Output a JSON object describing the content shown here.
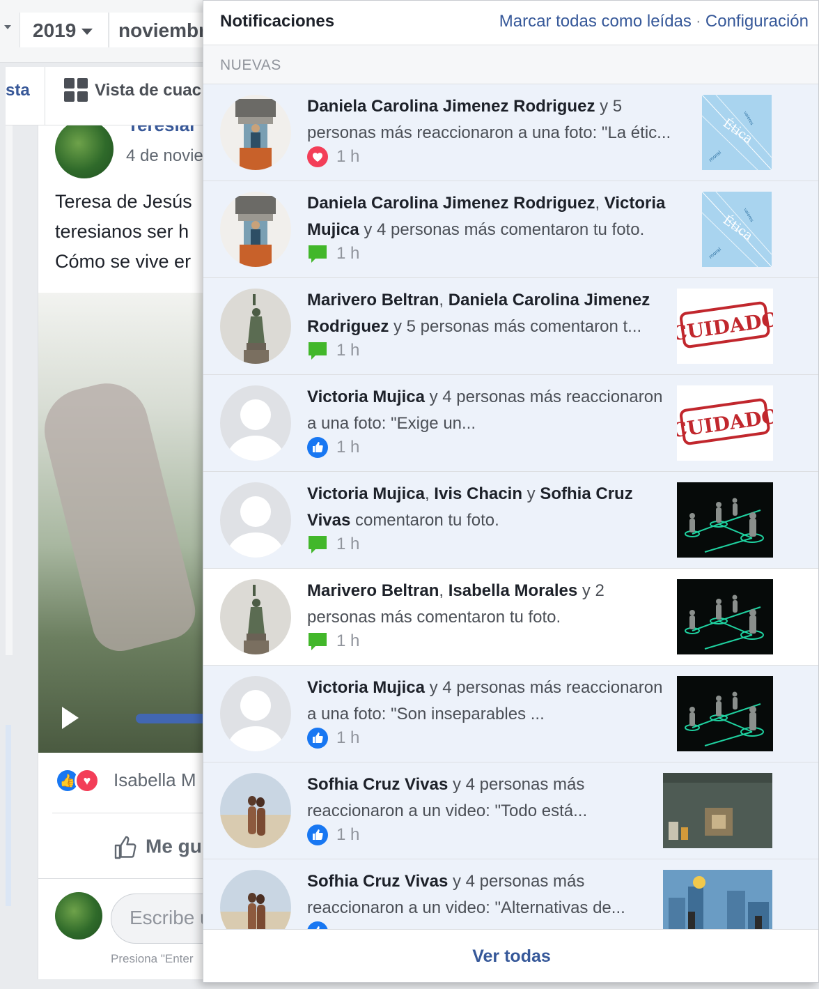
{
  "background_page": {
    "year_select": "2019",
    "month_select": "noviembr",
    "tab_list_partial": "sta",
    "tab_grid_partial": "Vista de cuac",
    "post_author_partial": "Teresiar",
    "post_date_partial": "4 de novie",
    "post_text_lines": [
      "Teresa de Jesús",
      "teresianos ser h",
      "Cómo se vive er"
    ],
    "reactors_partial": "Isabella M",
    "like_button_partial": "Me gu",
    "comment_placeholder_partial": "Escribe u",
    "comment_hint_partial": "Presiona \"Enter"
  },
  "panel": {
    "title": "Notificaciones",
    "mark_all_read": "Marcar todas como leídas",
    "separator": "·",
    "settings": "Configuración",
    "section_new": "NUEVAS",
    "see_all": "Ver todas"
  },
  "notifications": [
    {
      "segments": [
        {
          "text": "Daniela Carolina Jimenez Rodriguez",
          "bold": true
        },
        {
          "text": " y 5 personas más reaccionaron a una foto: \"La étic...",
          "bold": false
        }
      ],
      "icon": "love-reaction-icon",
      "time": "1 h",
      "state": "unread",
      "avatar": "statue-photo-avatar",
      "thumb": "etica-thumbnail"
    },
    {
      "segments": [
        {
          "text": "Daniela Carolina Jimenez Rodriguez",
          "bold": true
        },
        {
          "text": ", ",
          "bold": false
        },
        {
          "text": "Victoria Mujica",
          "bold": true
        },
        {
          "text": " y 4 personas más comentaron tu foto.",
          "bold": false
        }
      ],
      "icon": "comment-icon",
      "time": "1 h",
      "state": "unread",
      "avatar": "statue-photo-avatar",
      "thumb": "etica-thumbnail"
    },
    {
      "segments": [
        {
          "text": "Marivero Beltran",
          "bold": true
        },
        {
          "text": ", ",
          "bold": false
        },
        {
          "text": "Daniela Carolina Jimenez Rodriguez",
          "bold": true
        },
        {
          "text": " y 5 personas más comentaron t...",
          "bold": false
        }
      ],
      "icon": "comment-icon",
      "time": "1 h",
      "state": "unread",
      "avatar": "liberty-statue-avatar",
      "thumb": "cuidado-thumbnail"
    },
    {
      "segments": [
        {
          "text": "Victoria Mujica",
          "bold": true
        },
        {
          "text": " y 4 personas más reaccionaron a una foto: \"Exige un...",
          "bold": false
        }
      ],
      "icon": "like-reaction-icon",
      "time": "1 h",
      "state": "unread",
      "avatar": "default-profile-avatar",
      "thumb": "cuidado-thumbnail"
    },
    {
      "segments": [
        {
          "text": "Victoria Mujica",
          "bold": true
        },
        {
          "text": ", ",
          "bold": false
        },
        {
          "text": "Ivis Chacin",
          "bold": true
        },
        {
          "text": " y ",
          "bold": false
        },
        {
          "text": "Sofhia Cruz Vivas",
          "bold": true
        },
        {
          "text": " comentaron tu foto.",
          "bold": false
        }
      ],
      "icon": "comment-icon",
      "time": "1 h",
      "state": "unread",
      "avatar": "default-profile-avatar",
      "thumb": "network-thumbnail"
    },
    {
      "segments": [
        {
          "text": "Marivero Beltran",
          "bold": true
        },
        {
          "text": ", ",
          "bold": false
        },
        {
          "text": "Isabella Morales",
          "bold": true
        },
        {
          "text": " y 2 personas más comentaron tu foto.",
          "bold": false
        }
      ],
      "icon": "comment-icon",
      "time": "1 h",
      "state": "read",
      "avatar": "liberty-statue-avatar",
      "thumb": "network-thumbnail"
    },
    {
      "segments": [
        {
          "text": "Victoria Mujica",
          "bold": true
        },
        {
          "text": " y 4 personas más reaccionaron a una foto: \"Son inseparables ...",
          "bold": false
        }
      ],
      "icon": "like-reaction-icon",
      "time": "1 h",
      "state": "unread",
      "avatar": "default-profile-avatar",
      "thumb": "network-thumbnail"
    },
    {
      "segments": [
        {
          "text": "Sofhia Cruz Vivas",
          "bold": true
        },
        {
          "text": " y 4 personas más reaccionaron a un video: \"Todo está...",
          "bold": false
        }
      ],
      "icon": "like-reaction-icon",
      "time": "1 h",
      "state": "unread",
      "avatar": "beach-couple-avatar",
      "thumb": "video-thumbnail-1"
    },
    {
      "segments": [
        {
          "text": "Sofhia Cruz Vivas",
          "bold": true
        },
        {
          "text": " y 4 personas más reaccionaron a un video: \"Alternativas de...",
          "bold": false
        }
      ],
      "icon": "like-reaction-icon",
      "time": "",
      "state": "unread",
      "avatar": "beach-couple-avatar",
      "thumb": "video-thumbnail-2"
    }
  ],
  "colors": {
    "link": "#365899",
    "unread_bg": "#edf2fa",
    "like_blue": "#1877f2",
    "love_red": "#f33e58",
    "comment_green": "#42b72a"
  }
}
